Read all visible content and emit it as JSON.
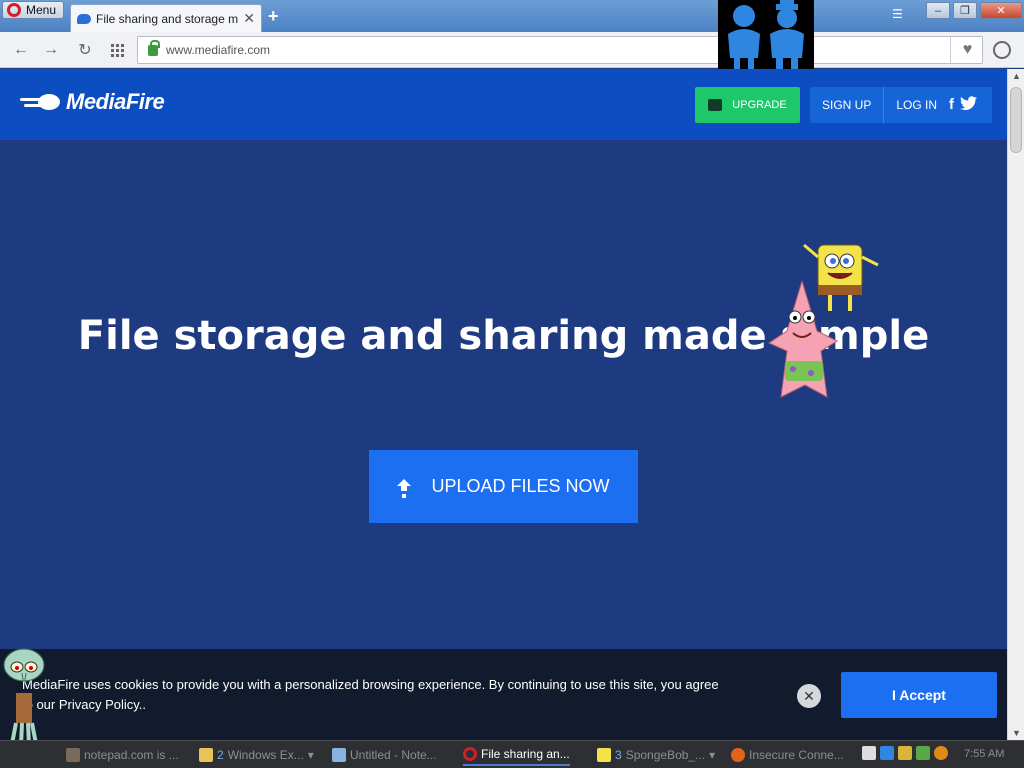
{
  "browser": {
    "menu_label": "Menu",
    "tab_title": "File sharing and storage made simple",
    "tab_close": "✕",
    "new_tab": "+",
    "url": "www.mediafire.com",
    "window_controls": {
      "minimize": "–",
      "maximize": "❐",
      "close": "✕"
    }
  },
  "site": {
    "logo_text": "MediaFire",
    "upgrade_label": "UPGRADE",
    "signup_label": "SIGN UP",
    "login_label": "LOG IN",
    "facebook_glyph": "f",
    "twitter_glyph": "🐦",
    "hero_title": "File storage and sharing made simple",
    "upload_label": "UPLOAD FILES NOW"
  },
  "cookie_bar": {
    "text": "MediaFire uses cookies to provide you with a personalized browsing experience. By continuing to use this site, you agree to our Privacy Policy..",
    "close_glyph": "✕",
    "accept_label": "I Accept"
  },
  "taskbar": {
    "tasks": [
      {
        "label": "notepad.com is ...",
        "count": ""
      },
      {
        "label": "Windows Ex...",
        "count": "2"
      },
      {
        "label": "Untitled - Note...",
        "count": ""
      },
      {
        "label": "File sharing an...",
        "count": ""
      },
      {
        "label": "SpongeBob_...",
        "count": "3"
      },
      {
        "label": "Insecure Conne...",
        "count": ""
      }
    ],
    "clock": "7:55 AM"
  },
  "colors": {
    "page_bg": "#1e3a80",
    "header_bg": "#0c4ec1",
    "upgrade_green": "#1ec76a",
    "primary_blue": "#1c6ff0"
  }
}
